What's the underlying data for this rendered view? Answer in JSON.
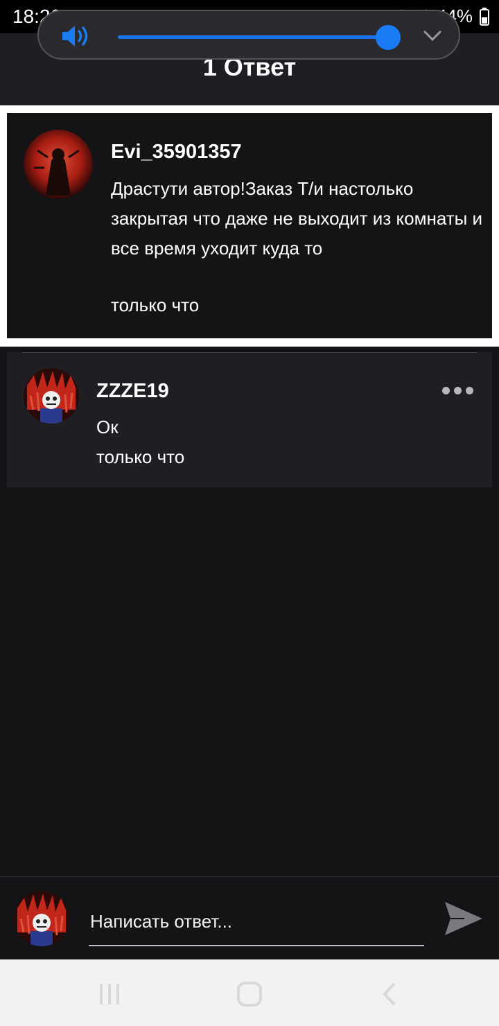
{
  "status_bar": {
    "time": "18:26",
    "battery": "44%",
    "icons": [
      "alarm-icon",
      "wifi-icon",
      "signal-icon",
      "signal-icon",
      "battery-icon"
    ]
  },
  "volume_popup": {
    "level_fraction": 0.96,
    "accent_color": "#1a7cf5",
    "icons": [
      "speaker-icon",
      "chevron-down-icon"
    ]
  },
  "header": {
    "title": "1 Ответ"
  },
  "post": {
    "username": "Evi_35901357",
    "text": "Драстути автор!Заказ\nТ/и настолько закрытая что даже не выходит из комнаты и все время уходит куда то",
    "time": "только что"
  },
  "reply": {
    "username": "ZZZE19",
    "text": "Ок",
    "time": "только что",
    "more_icon": "more-horizontal-icon"
  },
  "composer": {
    "placeholder": "Написать ответ...",
    "send_icon": "send-icon"
  },
  "nav_bar": {
    "icons": [
      "recent-apps-icon",
      "home-icon",
      "back-icon"
    ]
  }
}
